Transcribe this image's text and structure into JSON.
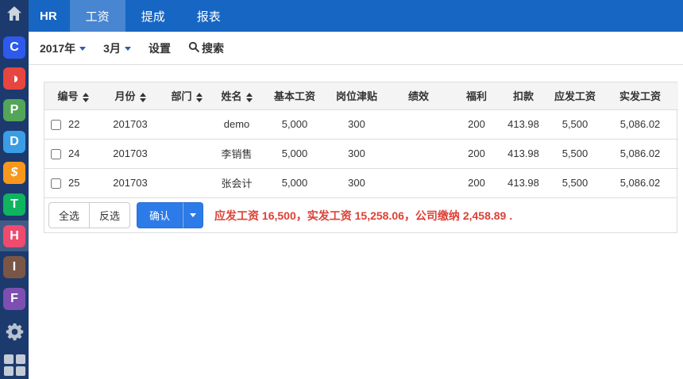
{
  "colors": {
    "sidebar_bg": "#1c3a6e",
    "nav_bg": "#1766c3",
    "nav_active_tab_bg": "#4886d2",
    "confirm_button": "#2c7be8",
    "summary_red": "#dc4136",
    "table_border": "#dddddd",
    "header_bg": "#f4f4f4"
  },
  "sidebar": {
    "items": [
      {
        "label": "C",
        "color": "#2e5aec"
      },
      {
        "label": "◑",
        "color": "#e64540"
      },
      {
        "label": "P",
        "color": "#53a558"
      },
      {
        "label": "D",
        "color": "#3b9de4"
      },
      {
        "label": "$",
        "color": "#f7981d"
      },
      {
        "label": "T",
        "color": "#10b35f"
      },
      {
        "label": "H",
        "color": "#ee4b6e",
        "active": true
      },
      {
        "label": "I",
        "color": "#7a5647"
      },
      {
        "label": "F",
        "color": "#7d4fb0"
      }
    ]
  },
  "nav": {
    "brand": "HR",
    "tabs": [
      {
        "label": "工资",
        "active": true
      },
      {
        "label": "提成",
        "active": false
      },
      {
        "label": "报表",
        "active": false
      }
    ]
  },
  "filters": {
    "year": "2017年",
    "month": "3月",
    "settings": "设置",
    "search": "搜索"
  },
  "table": {
    "columns": [
      {
        "label": "编号",
        "sortable": true
      },
      {
        "label": "月份",
        "sortable": true
      },
      {
        "label": "部门",
        "sortable": true
      },
      {
        "label": "姓名",
        "sortable": true
      },
      {
        "label": "基本工资",
        "sortable": false
      },
      {
        "label": "岗位津贴",
        "sortable": false
      },
      {
        "label": "绩效",
        "sortable": false
      },
      {
        "label": "福利",
        "sortable": false
      },
      {
        "label": "扣款",
        "sortable": false
      },
      {
        "label": "应发工资",
        "sortable": false
      },
      {
        "label": "实发工资",
        "sortable": false
      }
    ],
    "rows": [
      {
        "id": "22",
        "month": "201703",
        "dept": "",
        "name": "demo",
        "base": "5,000",
        "allowance": "300",
        "perf": "",
        "welfare": "200",
        "deduct": "413.98",
        "gross": "5,500",
        "net": "5,086.02"
      },
      {
        "id": "24",
        "month": "201703",
        "dept": "",
        "name": "李销售",
        "base": "5,000",
        "allowance": "300",
        "perf": "",
        "welfare": "200",
        "deduct": "413.98",
        "gross": "5,500",
        "net": "5,086.02"
      },
      {
        "id": "25",
        "month": "201703",
        "dept": "",
        "name": "张会计",
        "base": "5,000",
        "allowance": "300",
        "perf": "",
        "welfare": "200",
        "deduct": "413.98",
        "gross": "5,500",
        "net": "5,086.02"
      }
    ]
  },
  "footer": {
    "select_all": "全选",
    "invert_select": "反选",
    "confirm": "确认",
    "summary": "应发工资 16,500，实发工资 15,258.06，公司缴纳 2,458.89 ."
  }
}
